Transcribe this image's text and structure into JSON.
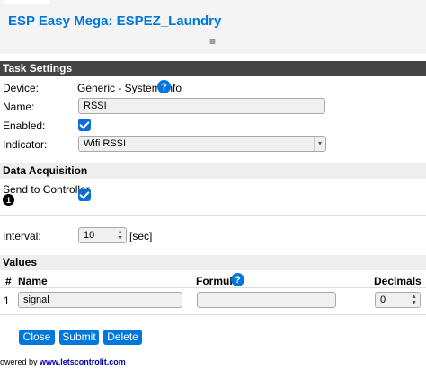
{
  "app": {
    "title": "ESP Easy Mega: ESPEZ_Laundry",
    "menu_icon": "≡"
  },
  "task_settings": {
    "header": "Task Settings",
    "device_label": "Device:",
    "device_value": "Generic - System Info",
    "name_label": "Name:",
    "name_value": "RSSI",
    "enabled_label": "Enabled:",
    "enabled": true,
    "indicator_label": "Indicator:",
    "indicator_value": "Wifi RSSI"
  },
  "data_acquisition": {
    "header": "Data Acquisition",
    "send_label": "Send to Controller",
    "controller_number": "1",
    "send_enabled": true,
    "interval_label": "Interval:",
    "interval_value": "10",
    "interval_unit": "[sec]"
  },
  "values": {
    "header": "Values",
    "columns": {
      "index": "#",
      "name": "Name",
      "formula": "Formula",
      "decimals": "Decimals"
    },
    "rows": [
      {
        "index": "1",
        "name": "signal",
        "formula": "",
        "decimals": "0"
      }
    ]
  },
  "buttons": {
    "close": "Close",
    "submit": "Submit",
    "delete": "Delete"
  },
  "footer": {
    "prefix": "owered by ",
    "link": "www.letscontrolit.com"
  },
  "colors": {
    "accent": "#0077dd",
    "section_dark": "#444444",
    "section_light": "#eeeeee"
  },
  "help_icon": "?"
}
